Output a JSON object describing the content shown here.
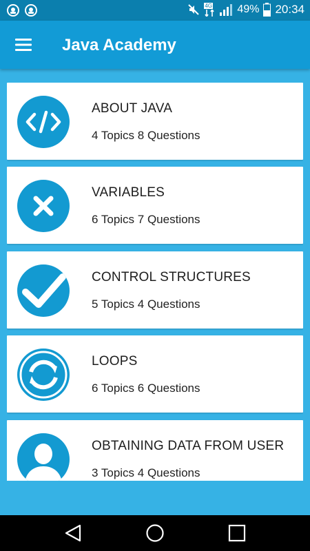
{
  "status_bar": {
    "battery": "49%",
    "time": "20:34",
    "network_badge": "4G",
    "icons": [
      "notification-icon",
      "notification-icon",
      "mute-icon",
      "network-icon",
      "signal-icon",
      "battery-icon"
    ]
  },
  "app_bar": {
    "title": "Java Academy",
    "menu_icon": "hamburger-menu-icon"
  },
  "courses": [
    {
      "title": "ABOUT JAVA",
      "subtitle": "4 Topics 8 Questions",
      "icon": "code-icon"
    },
    {
      "title": "VARIABLES",
      "subtitle": "6 Topics 7 Questions",
      "icon": "x-icon"
    },
    {
      "title": "CONTROL STRUCTURES",
      "subtitle": "5 Topics 4 Questions",
      "icon": "checkmark-icon"
    },
    {
      "title": "LOOPS",
      "subtitle": "6 Topics 6 Questions",
      "icon": "refresh-icon"
    },
    {
      "title": "OBTAINING DATA FROM USER",
      "subtitle": "3 Topics 4 Questions",
      "icon": "user-icon"
    }
  ],
  "nav_bar": {
    "buttons": [
      "back-icon",
      "home-icon",
      "recents-icon"
    ]
  },
  "colors": {
    "status_bar": "#0b7fae",
    "app_bar": "#129bd6",
    "background": "#36b2e5",
    "icon_circle": "#139ad1"
  }
}
